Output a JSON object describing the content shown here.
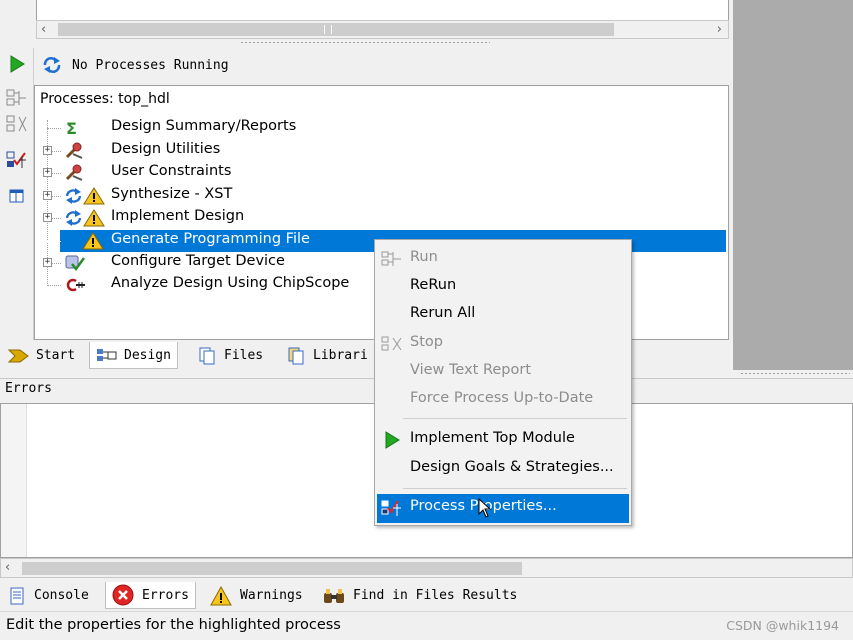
{
  "process_status": "No Processes Running",
  "processes_title": "Processes: top_hdl",
  "tree": [
    {
      "label": "Design Summary/Reports",
      "icon": "sigma-icon",
      "expandable": false
    },
    {
      "label": "Design Utilities",
      "icon": "tools-icon",
      "expandable": true
    },
    {
      "label": "User Constraints",
      "icon": "tools-icon",
      "expandable": true
    },
    {
      "label": "Synthesize - XST",
      "icon": "refresh-warning-icon",
      "expandable": true
    },
    {
      "label": "Implement Design",
      "icon": "refresh-warning-icon",
      "expandable": true
    },
    {
      "label": "Generate Programming File",
      "icon": "warning-icon",
      "expandable": false,
      "selected": true
    },
    {
      "label": "Configure Target Device",
      "icon": "device-icon",
      "expandable": true
    },
    {
      "label": "Analyze Design Using ChipScope",
      "icon": "chipscope-icon",
      "expandable": false
    }
  ],
  "panel_tabs": [
    {
      "label": "Start",
      "icon": "start-arrow-icon"
    },
    {
      "label": "Design",
      "icon": "design-hierarchy-icon",
      "active": true
    },
    {
      "label": "Files",
      "icon": "files-icon"
    },
    {
      "label": "Librari",
      "icon": "libraries-icon"
    }
  ],
  "errors_panel_title": "Errors",
  "context_menu": [
    {
      "label": "Run",
      "icon": "run-process-icon",
      "disabled": true
    },
    {
      "label": "ReRun",
      "disabled": false
    },
    {
      "label": "Rerun All",
      "disabled": false
    },
    {
      "label": "Stop",
      "icon": "stop-process-icon",
      "disabled": true
    },
    {
      "label": "View Text Report",
      "disabled": true
    },
    {
      "label": "Force Process Up-to-Date",
      "disabled": true
    },
    {
      "separator": true
    },
    {
      "label": "Implement Top Module",
      "icon": "green-play-icon",
      "disabled": false
    },
    {
      "label": "Design Goals & Strategies...",
      "disabled": false
    },
    {
      "separator": true
    },
    {
      "label": "Process Properties...",
      "icon": "process-properties-icon",
      "highlighted": true
    }
  ],
  "bottom_tabs": [
    {
      "label": "Console",
      "icon": "console-icon"
    },
    {
      "label": "Errors",
      "icon": "error-circle-icon",
      "active": true
    },
    {
      "label": "Warnings",
      "icon": "warning-icon"
    },
    {
      "label": "Find in Files Results",
      "icon": "binoculars-icon"
    }
  ],
  "status_bar_text": "Edit the properties for the highlighted process",
  "watermark": "CSDN @whik1194",
  "colors": {
    "selection": "#0078d7",
    "menu_bg": "#f2f2f2",
    "panel_bg": "#f0f0f0",
    "dark_gray": "#ababab"
  }
}
